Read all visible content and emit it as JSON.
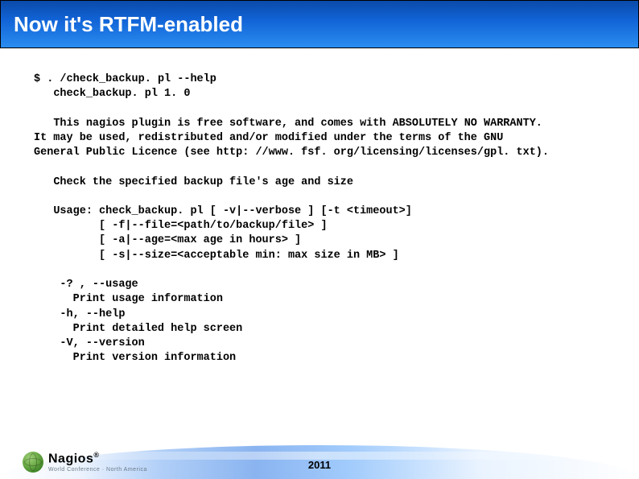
{
  "header": {
    "title": "Now it's RTFM-enabled"
  },
  "terminal": {
    "prompt": "$",
    "command": ". /check_backup. pl --help",
    "version_line": "check_backup. pl 1. 0",
    "warranty": "This nagios plugin is free software, and comes with ABSOLUTELY NO WARRANTY.\nIt may be used, redistributed and/or modified under the terms of the GNU\nGeneral Public Licence (see http: //www. fsf. org/licensing/licenses/gpl. txt).",
    "description": "Check the specified backup file's age and size",
    "usage_lines": [
      "Usage: check_backup. pl [ -v|--verbose ] [-t <timeout>]",
      "       [ -f|--file=<path/to/backup/file> ]",
      "       [ -a|--age=<max age in hours> ]",
      "       [ -s|--size=<acceptable min: max size in MB> ]"
    ],
    "options": [
      {
        "flag": " -? , --usage",
        "desc": "   Print usage information"
      },
      {
        "flag": " -h, --help",
        "desc": "   Print detailed help screen"
      },
      {
        "flag": " -V, --version",
        "desc": "   Print version information"
      }
    ]
  },
  "footer": {
    "year": "2011",
    "logo_name": "Nagios",
    "logo_reg": "®",
    "logo_sub": "World Conference · North America"
  }
}
